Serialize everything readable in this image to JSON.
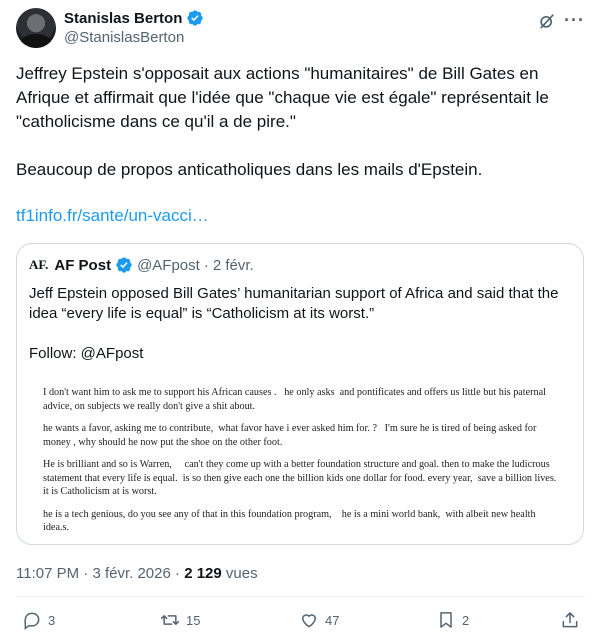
{
  "author": {
    "name": "Stanislas Berton",
    "handle": "@StanislasBerton"
  },
  "tweet": {
    "paragraph1": "Jeffrey Epstein s'opposait aux actions \"humanitaires\" de Bill Gates en Afrique et affirmait que l'idée que \"chaque vie est égale\" représentait le \"catholicisme dans ce qu'il a de pire.\"",
    "paragraph2": "Beaucoup de propos anticatholiques dans les mails d'Epstein.",
    "link": "tf1info.fr/sante/un-vacci…"
  },
  "quote": {
    "logo": "AF.",
    "name": "AF Post",
    "handle": "@AFpost",
    "separator": "·",
    "date": "2 févr.",
    "text1": "Jeff Epstein opposed Bill Gates’ humanitarian support of Africa and said that the idea “every life is equal” is “Catholicism at its worst.”",
    "text2": "Follow: @AFpost",
    "document": [
      "I don't want him to ask me to support his African causes .   he only asks  and pontificates and offers us little but his paternal advice, on subjects we really don't give a shit about.",
      "he wants a favor, asking me to contribute,  what favor have i ever asked him for. ?   I'm sure he is tired of being asked for money , why should he now put the shoe on the other foot.",
      "He is brilliant and so is Warren,     can't they come up with a better foundation structure and goal. then to make the ludicrous statement that every life is equal.  is so then give each one the billion kids one dollar for food. every year,  save a billion lives.  it is Catholicism at is worst.",
      "he is a tech genious, do you see any of that in this foundation program,    he is a mini world bank,  with albeit new health idea.s."
    ]
  },
  "meta": {
    "time": "11:07 PM",
    "separator": "·",
    "date": "3 févr. 2026",
    "separator2": "·",
    "views_count": "2 129",
    "views_label": "vues"
  },
  "actions": {
    "replies": "3",
    "reposts": "15",
    "likes": "47",
    "bookmarks": "2"
  },
  "colors": {
    "link": "#1d9bf0",
    "secondary_text": "#536471",
    "verified": "#1d9bf0"
  },
  "icons": [
    "verified-badge-icon",
    "grok-icon",
    "more-icon",
    "reply-icon",
    "repost-icon",
    "like-icon",
    "bookmark-icon",
    "share-icon"
  ]
}
